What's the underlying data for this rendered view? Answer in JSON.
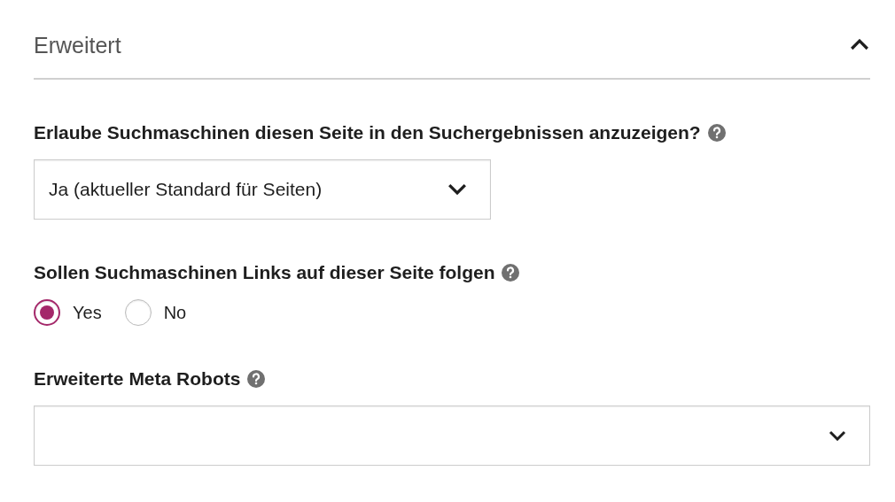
{
  "section": {
    "title": "Erweitert",
    "expanded": true
  },
  "fields": [
    {
      "kind": "select",
      "label": "Erlaube Suchmaschinen diesen Seite in den Suchergebnissen anzuzeigen?",
      "help": true,
      "value": "Ja (aktueller Standard für Seiten)",
      "wide": false
    },
    {
      "kind": "radio",
      "label": "Sollen Suchmaschinen Links auf dieser Seite folgen",
      "help": true,
      "options": [
        {
          "label": "Yes",
          "selected": true
        },
        {
          "label": "No",
          "selected": false
        }
      ]
    },
    {
      "kind": "select",
      "label": "Erweiterte Meta Robots",
      "help": true,
      "wide": true
    }
  ]
}
